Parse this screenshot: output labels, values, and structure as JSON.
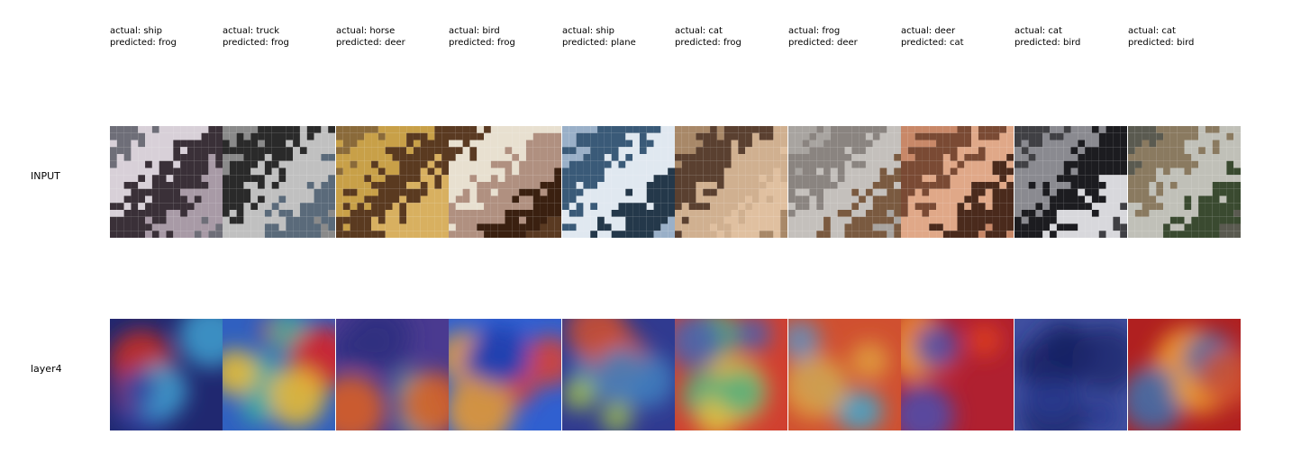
{
  "row_labels": [
    "INPUT",
    "layer4"
  ],
  "samples": [
    {
      "actual": "actual: ship",
      "predicted": "predicted: frog"
    },
    {
      "actual": "actual: truck",
      "predicted": "predicted: frog"
    },
    {
      "actual": "actual: horse",
      "predicted": "predicted: deer"
    },
    {
      "actual": "actual: bird",
      "predicted": "predicted: frog"
    },
    {
      "actual": "actual: ship",
      "predicted": "predicted: plane"
    },
    {
      "actual": "actual: cat",
      "predicted": "predicted: frog"
    },
    {
      "actual": "actual: frog",
      "predicted": "predicted: deer"
    },
    {
      "actual": "actual: deer",
      "predicted": "predicted: cat"
    },
    {
      "actual": "actual: cat",
      "predicted": "predicted: bird"
    },
    {
      "actual": "actual: cat",
      "predicted": "predicted: bird"
    }
  ],
  "input_palettes": [
    [
      "#6e6e78",
      "#d8d0d8",
      "#3a3038",
      "#a89aa6"
    ],
    [
      "#8a8a8a",
      "#2a2a2a",
      "#c0c0c0",
      "#5a6a7a"
    ],
    [
      "#8a6a3a",
      "#c8a048",
      "#5a3a20",
      "#d8b060"
    ],
    [
      "#5a3a22",
      "#e8e0d0",
      "#b09080",
      "#3a2010"
    ],
    [
      "#9ab0c8",
      "#3a5a78",
      "#e0e8f0",
      "#24384a"
    ],
    [
      "#a88868",
      "#5a4030",
      "#d0b090",
      "#e0c0a0"
    ],
    [
      "#a8a4a0",
      "#8a8480",
      "#c4c0bc",
      "#7a5a40"
    ],
    [
      "#c88868",
      "#7a4a34",
      "#e0a888",
      "#4a2a1c"
    ],
    [
      "#404044",
      "#8a8a90",
      "#1c1c20",
      "#d8d8dc"
    ],
    [
      "#5a5a50",
      "#8a7a60",
      "#c0c0b8",
      "#3a4a30"
    ]
  ],
  "heat_palettes": [
    [
      "#3040a0",
      "#d03020",
      "#40a0d0",
      "#202870"
    ],
    [
      "#40b0a0",
      "#e02020",
      "#f0c030",
      "#3060c0"
    ],
    [
      "#303080",
      "#50a0a0",
      "#e06020",
      "#4a3a90"
    ],
    [
      "#2040b0",
      "#e04030",
      "#f0a030",
      "#3060d0"
    ],
    [
      "#4080c0",
      "#d05030",
      "#a0c050",
      "#303a90"
    ],
    [
      "#50b080",
      "#e0c040",
      "#4a60b0",
      "#d04030"
    ],
    [
      "#50a0c0",
      "#e0a040",
      "#6090c0",
      "#d05030"
    ],
    [
      "#e04020",
      "#f0a030",
      "#4a50b0",
      "#b02030"
    ],
    [
      "#202a70",
      "#2a3a90",
      "#182060",
      "#4050a0"
    ],
    [
      "#d05030",
      "#f0a030",
      "#3a70b0",
      "#b02020"
    ]
  ]
}
